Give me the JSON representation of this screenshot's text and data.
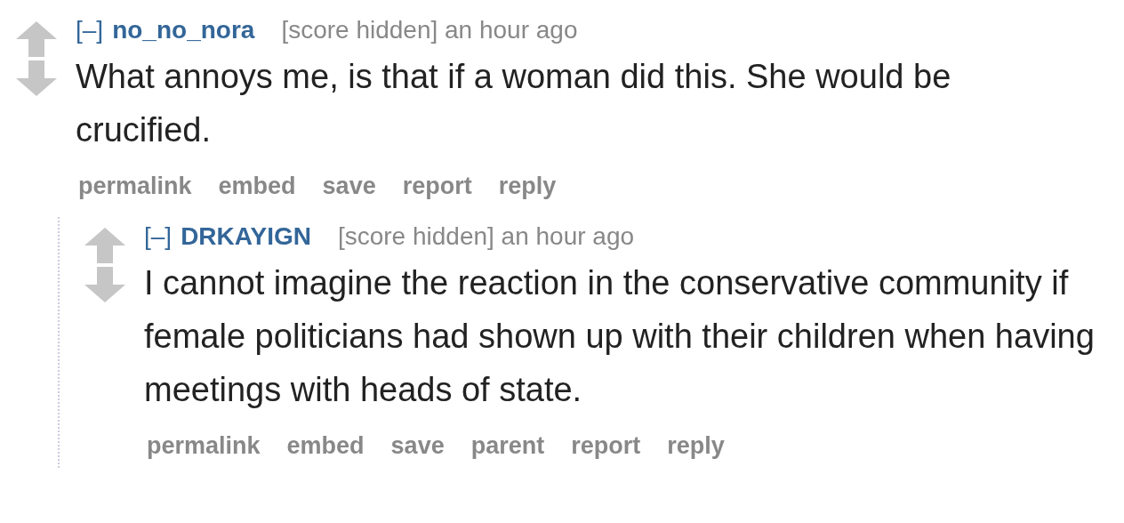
{
  "comments": [
    {
      "collapse": "[–]",
      "author": "no_no_nora",
      "score": "[score hidden]",
      "time": "an hour ago",
      "body": "What annoys me, is that if a woman did this. She would be crucified.",
      "actions": [
        "permalink",
        "embed",
        "save",
        "report",
        "reply"
      ],
      "children": [
        {
          "collapse": "[–]",
          "author": "DRKAYIGN",
          "score": "[score hidden]",
          "time": "an hour ago",
          "body": "I cannot imagine the reaction in the conservative community if female politicians had shown up with their children when having meetings with heads of state.",
          "actions": [
            "permalink",
            "embed",
            "save",
            "parent",
            "report",
            "reply"
          ]
        }
      ]
    }
  ]
}
